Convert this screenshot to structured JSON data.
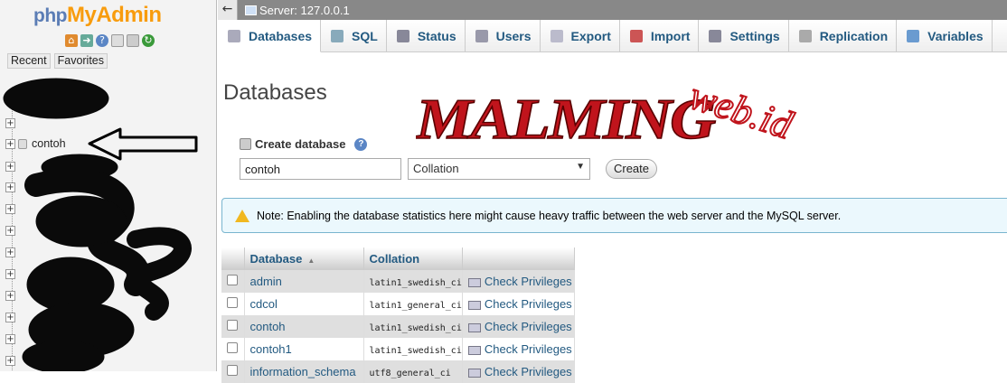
{
  "logo": {
    "php": "php",
    "my": "My",
    "admin": "Admin"
  },
  "nav": {
    "tabs": [
      "Recent",
      "Favorites"
    ],
    "selected_db": "contoh"
  },
  "topbar": {
    "back": "←",
    "server": "Server: 127.0.0.1"
  },
  "menu": {
    "tabs": [
      {
        "label": "Databases",
        "icon": "database-icon",
        "color": "#aab"
      },
      {
        "label": "SQL",
        "icon": "sql-icon",
        "color": "#8ab"
      },
      {
        "label": "Status",
        "icon": "status-icon",
        "color": "#889"
      },
      {
        "label": "Users",
        "icon": "users-icon",
        "color": "#99a"
      },
      {
        "label": "Export",
        "icon": "export-icon",
        "color": "#bbc"
      },
      {
        "label": "Import",
        "icon": "import-icon",
        "color": "#c55"
      },
      {
        "label": "Settings",
        "icon": "wrench-icon",
        "color": "#889"
      },
      {
        "label": "Replication",
        "icon": "replication-icon",
        "color": "#aaa"
      },
      {
        "label": "Variables",
        "icon": "variables-icon",
        "color": "#6a9bd0"
      }
    ]
  },
  "page_title": "Databases",
  "watermark": {
    "main": "MALMING",
    "sub": "web.id"
  },
  "create": {
    "heading": "Create database",
    "name_value": "contoh",
    "collation_value": "Collation",
    "button": "Create"
  },
  "notice": "Note: Enabling the database statistics here might cause heavy traffic between the web server and the MySQL server.",
  "table": {
    "headers": {
      "database": "Database",
      "collation": "Collation"
    },
    "rows": [
      {
        "name": "admin",
        "collation": "latin1_swedish_ci",
        "action": "Check Privileges"
      },
      {
        "name": "cdcol",
        "collation": "latin1_general_ci",
        "action": "Check Privileges"
      },
      {
        "name": "contoh",
        "collation": "latin1_swedish_ci",
        "action": "Check Privileges"
      },
      {
        "name": "contoh1",
        "collation": "latin1_swedish_ci",
        "action": "Check Privileges"
      },
      {
        "name": "information_schema",
        "collation": "utf8_general_ci",
        "action": "Check Privileges"
      }
    ]
  },
  "colors": {
    "link": "#235a81",
    "logo_orange": "#f89c0e",
    "logo_blue": "#5b7db5",
    "watermark_red": "#c0141c"
  }
}
